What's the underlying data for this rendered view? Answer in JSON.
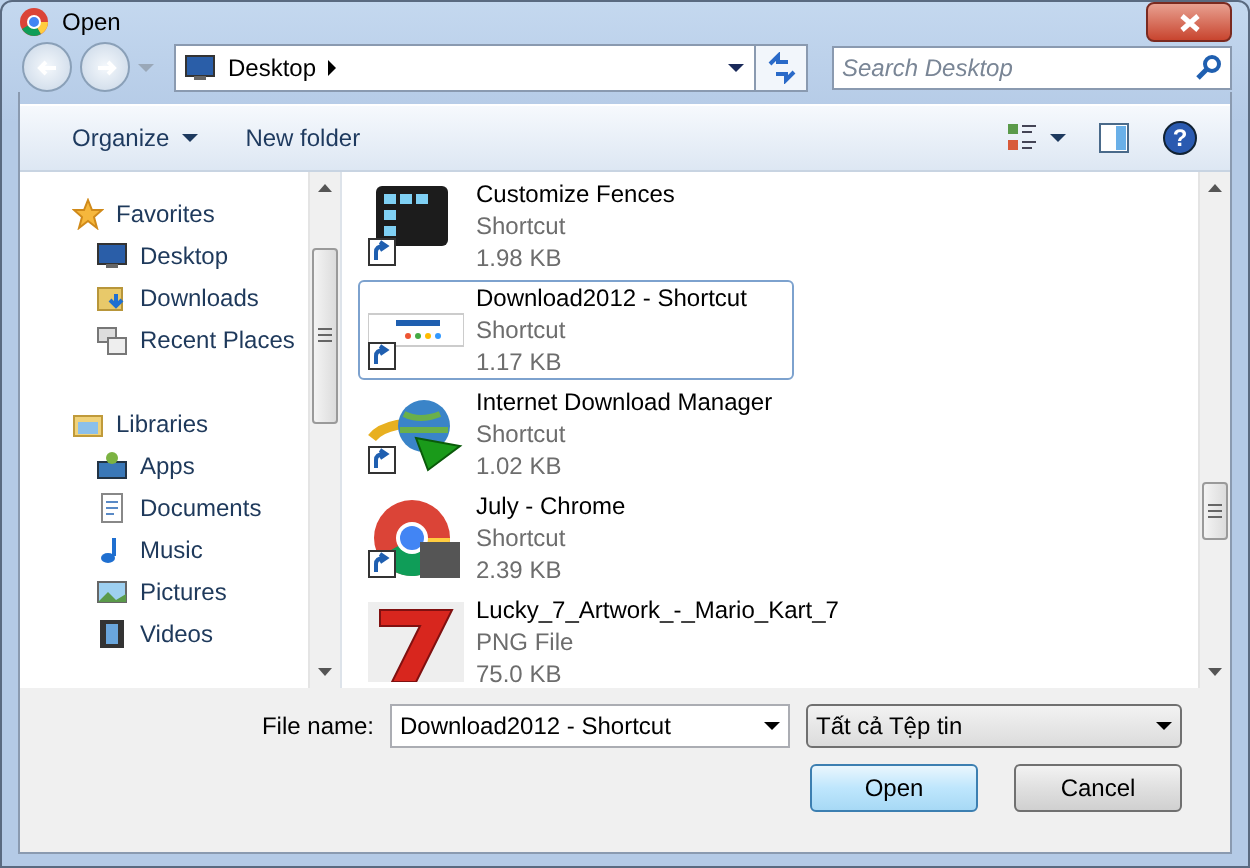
{
  "window": {
    "title": "Open"
  },
  "address": {
    "location": "Desktop"
  },
  "search": {
    "placeholder": "Search Desktop"
  },
  "toolbar": {
    "organize": "Organize",
    "new_folder": "New folder",
    "help": "?"
  },
  "sidebar": {
    "groups": [
      {
        "label": "Favorites",
        "kind": "favorites",
        "items": [
          {
            "label": "Desktop",
            "kind": "desktop"
          },
          {
            "label": "Downloads",
            "kind": "downloads"
          },
          {
            "label": "Recent Places",
            "kind": "recent"
          }
        ]
      },
      {
        "label": "Libraries",
        "kind": "libraries",
        "items": [
          {
            "label": "Apps",
            "kind": "apps"
          },
          {
            "label": "Documents",
            "kind": "documents"
          },
          {
            "label": "Music",
            "kind": "music"
          },
          {
            "label": "Pictures",
            "kind": "pictures"
          },
          {
            "label": "Videos",
            "kind": "videos"
          }
        ]
      }
    ]
  },
  "files": [
    {
      "name": "Customize Fences",
      "type": "Shortcut",
      "size": "1.98 KB",
      "kind": "fences",
      "shortcut": true,
      "selected": false
    },
    {
      "name": "Download2012 - Shortcut",
      "type": "Shortcut",
      "size": "1.17 KB",
      "kind": "website",
      "shortcut": true,
      "selected": true
    },
    {
      "name": "Internet Download Manager",
      "type": "Shortcut",
      "size": "1.02 KB",
      "kind": "globe",
      "shortcut": true,
      "selected": false
    },
    {
      "name": "July - Chrome",
      "type": "Shortcut",
      "size": "2.39 KB",
      "kind": "chrome",
      "shortcut": true,
      "selected": false
    },
    {
      "name": "Lucky_7_Artwork_-_Mario_Kart_7",
      "type": "PNG File",
      "size": "75.0 KB",
      "kind": "seven",
      "shortcut": false,
      "selected": false
    }
  ],
  "footer": {
    "file_name_label": "File name:",
    "file_name": "Download2012 - Shortcut",
    "file_type": "Tất cả Tệp tin",
    "buttons": [
      {
        "label": "Open",
        "kind": "default"
      },
      {
        "label": "Cancel",
        "kind": "normal"
      }
    ]
  }
}
